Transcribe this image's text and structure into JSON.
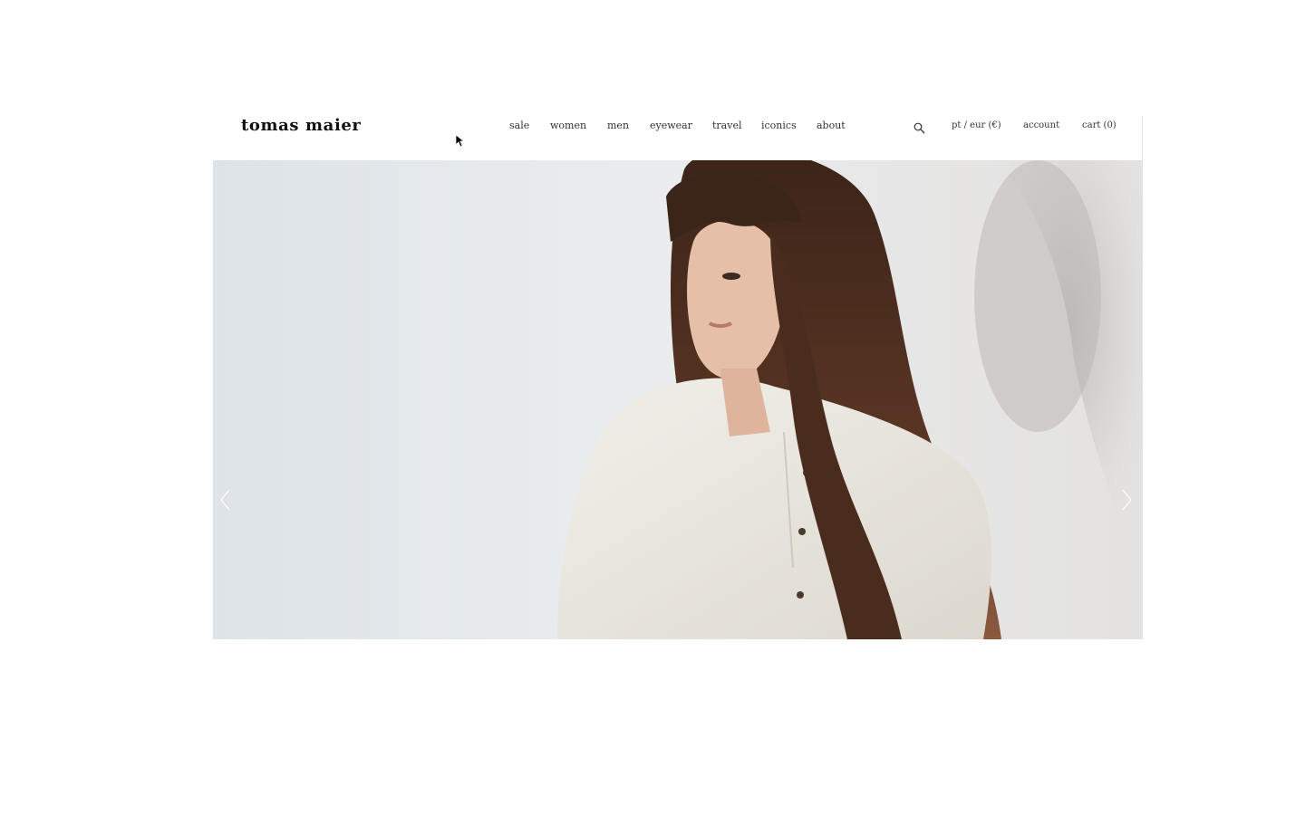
{
  "brand": {
    "logo": "tomas maier"
  },
  "nav": {
    "items": [
      {
        "label": "sale"
      },
      {
        "label": "women"
      },
      {
        "label": "men"
      },
      {
        "label": "eyewear"
      },
      {
        "label": "travel"
      },
      {
        "label": "iconics"
      },
      {
        "label": "about"
      }
    ]
  },
  "utility": {
    "search_icon": "search-icon",
    "locale": "pt / eur (€)",
    "account": "account",
    "cart": "cart (0)"
  },
  "hero": {
    "prev_icon": "chevron-left-icon",
    "next_icon": "chevron-right-icon"
  }
}
